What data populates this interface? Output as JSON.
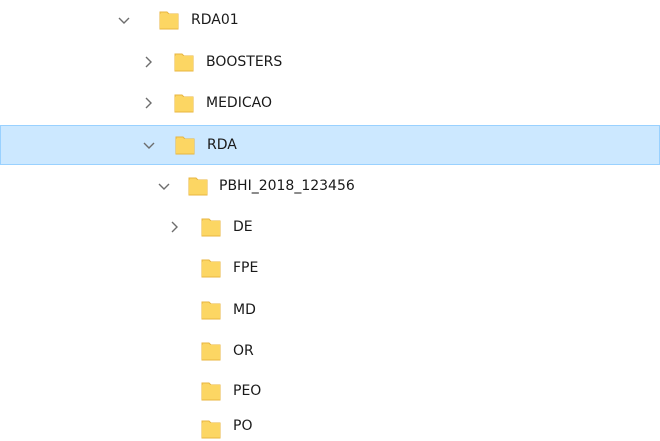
{
  "tree": {
    "colors": {
      "selection_bg": "#cce8ff",
      "selection_border": "#99d1ff",
      "folder_fill": "#fcd663",
      "folder_tab": "#e8b53f",
      "chevron": "#6d6d6d"
    },
    "nodes": [
      {
        "label": "RDA01",
        "state": "expanded",
        "icon": "folder-icon"
      },
      {
        "label": "BOOSTERS",
        "state": "collapsed",
        "icon": "folder-icon"
      },
      {
        "label": "MEDICAO",
        "state": "collapsed",
        "icon": "folder-icon"
      },
      {
        "label": "RDA",
        "state": "expanded",
        "selected": true,
        "icon": "folder-icon"
      },
      {
        "label": "PBHI_2018_123456",
        "state": "expanded",
        "icon": "folder-icon"
      },
      {
        "label": "DE",
        "state": "collapsed",
        "icon": "folder-icon"
      },
      {
        "label": "FPE",
        "state": "leaf",
        "icon": "folder-icon"
      },
      {
        "label": "MD",
        "state": "leaf",
        "icon": "folder-icon"
      },
      {
        "label": "OR",
        "state": "leaf",
        "icon": "folder-icon"
      },
      {
        "label": "PEO",
        "state": "leaf",
        "icon": "folder-icon"
      },
      {
        "label": "PO",
        "state": "leaf",
        "icon": "folder-icon"
      }
    ]
  }
}
